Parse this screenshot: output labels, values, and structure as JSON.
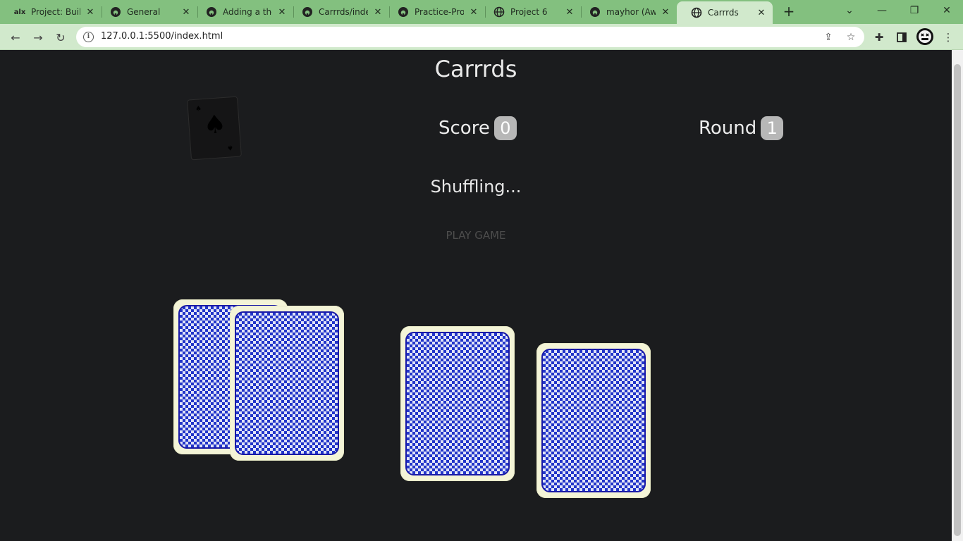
{
  "browser": {
    "tabs": [
      {
        "label": "Project: Build",
        "favicon": "alx-logo",
        "active": false
      },
      {
        "label": "General",
        "favicon": "github-icon",
        "active": false
      },
      {
        "label": "Adding a the",
        "favicon": "github-icon",
        "active": false
      },
      {
        "label": "Carrrds/index",
        "favicon": "github-icon",
        "active": false
      },
      {
        "label": "Practice-Proje",
        "favicon": "github-icon",
        "active": false
      },
      {
        "label": "Project 6",
        "favicon": "globe-icon",
        "active": false
      },
      {
        "label": "mayhor (Awo",
        "favicon": "github-icon",
        "active": false
      },
      {
        "label": "Carrrds",
        "favicon": "globe-icon",
        "active": true
      }
    ],
    "favicon_text_alx": "alx",
    "url": "127.0.0.1:5500/index.html",
    "colors": {
      "tabbar": "#83c07f",
      "toolbar": "#d1e9cc"
    }
  },
  "game": {
    "title": "Carrrds",
    "score_label": "Score",
    "score_value": "0",
    "round_label": "Round",
    "round_value": "1",
    "status_text": "Shuffling...",
    "play_button": "PLAY GAME",
    "deck_card": "ace-of-spades",
    "card_back_color": "#2235c9",
    "card_count": 5
  }
}
